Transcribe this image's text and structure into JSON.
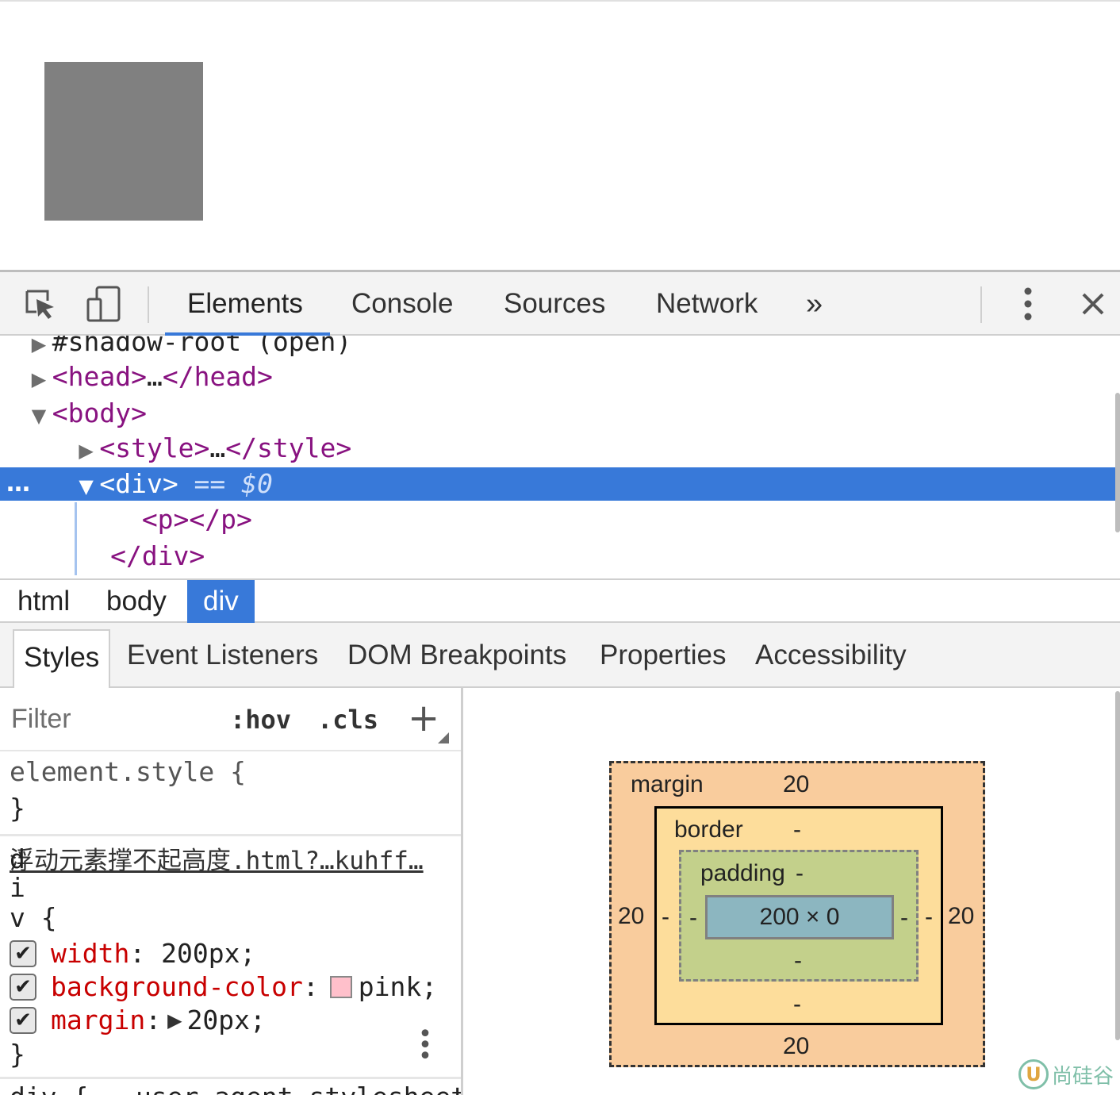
{
  "toolbar": {
    "tabs": [
      "Elements",
      "Console",
      "Sources",
      "Network"
    ],
    "more_tabs": "»",
    "inspect_icon": "inspect-cursor-icon",
    "device_icon": "device-toggle-icon"
  },
  "dom": {
    "lines": {
      "shadow": "#shadow-root (open)",
      "head_open": "<head>",
      "head_ellipsis": "…",
      "head_close": "</head>",
      "body_open": "<body>",
      "style_open": "<style>",
      "style_ellipsis": "…",
      "style_close": "</style>",
      "div_open": "<div>",
      "div_marker": " == $0",
      "p_open": "<p>",
      "p_close": "</p>",
      "div_close": "</div>"
    },
    "selected_ellipsis": "…"
  },
  "breadcrumb": [
    "html",
    "body",
    "div"
  ],
  "subtabs": [
    "Styles",
    "Event Listeners",
    "DOM Breakpoints",
    "Properties",
    "Accessibility"
  ],
  "styles": {
    "filter_placeholder": "Filter",
    "hov": ":hov",
    "cls": ".cls",
    "plus": "+",
    "element_style_selector": "element.style {",
    "close_brace": "}",
    "source_link": "浮动元素撑不起高度.html?…kuhff…",
    "selector_chars": [
      "d",
      "i",
      "v {"
    ],
    "properties": [
      {
        "name": "width",
        "value": "200px;"
      },
      {
        "name": "background-color",
        "value": "pink;",
        "swatch": "#ffc0cb"
      },
      {
        "name": "margin",
        "value": "20px;"
      }
    ],
    "next_rule": "div {   user agent stylesheet"
  },
  "box_model": {
    "margin_label": "margin",
    "margin": {
      "top": "20",
      "right": "20",
      "bottom": "20",
      "left": "20"
    },
    "border_label": "border",
    "border": {
      "top": "-",
      "right": "-",
      "bottom": "-",
      "left": "-"
    },
    "padding_label": "padding",
    "padding": {
      "top": "-",
      "right": "-",
      "bottom": "-",
      "left": "-"
    },
    "content": "200 × 0",
    "colors": {
      "margin": "#f9cc9d",
      "border": "#fddd9b",
      "padding": "#c3d08b",
      "content": "#8cb6c0"
    }
  },
  "watermark": {
    "logo": "U",
    "text": "尚硅谷"
  },
  "colors": {
    "accent": "#3879d9",
    "tag": "#881280",
    "prop_name": "#c80000"
  }
}
